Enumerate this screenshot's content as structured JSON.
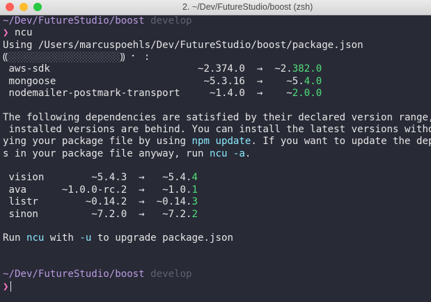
{
  "window": {
    "title": "2. ~/Dev/FutureStudio/boost (zsh)",
    "traffic_lights": [
      {
        "name": "close",
        "color": "#fe5f57"
      },
      {
        "name": "minimize",
        "color": "#febc2e"
      },
      {
        "name": "zoom",
        "color": "#28c840"
      }
    ]
  },
  "terminal": {
    "lines": [
      [
        {
          "t": "~/Dev/FutureStudio/boost",
          "c": "purple"
        },
        {
          "t": " develop",
          "c": "gray"
        }
      ],
      [
        {
          "t": "❯",
          "c": "pink"
        },
        {
          "t": " ncu",
          "c": "default"
        }
      ],
      [
        {
          "t": "Using /Users/marcuspoehls/Dev/FutureStudio/boost/package.json",
          "c": "default"
        }
      ],
      [
        {
          "t": "⸨",
          "c": "default"
        },
        {
          "t": "░░░░░░░░░░░░░░░░░░░",
          "c": "bar"
        },
        {
          "t": "⸩ ⠂ :",
          "c": "default"
        }
      ],
      [
        {
          "t": " aws-sdk                         ~2.374.0  →  ~2.",
          "c": "default"
        },
        {
          "t": "382.0",
          "c": "green"
        }
      ],
      [
        {
          "t": " mongoose                         ~5.3.16  →    ~5.",
          "c": "default"
        },
        {
          "t": "4.0",
          "c": "green"
        }
      ],
      [
        {
          "t": " nodemailer-postmark-transport     ~1.4.0  →    ~",
          "c": "default"
        },
        {
          "t": "2.0.0",
          "c": "green"
        }
      ],
      [],
      [
        {
          "t": "The following dependencies are satisfied by their declared version range, but the",
          "c": "default"
        }
      ],
      [
        {
          "t": " installed versions are behind. You can install the latest versions without modif",
          "c": "default"
        }
      ],
      [
        {
          "t": "ying your package file by using ",
          "c": "default"
        },
        {
          "t": "npm update",
          "c": "cyan"
        },
        {
          "t": ". If you want to update the dependencie",
          "c": "default"
        }
      ],
      [
        {
          "t": "s in your package file anyway, run ",
          "c": "default"
        },
        {
          "t": "ncu -a",
          "c": "cyan"
        },
        {
          "t": ".",
          "c": "default"
        }
      ],
      [],
      [
        {
          "t": " vision        ~5.4.3  →   ~5.4.",
          "c": "default"
        },
        {
          "t": "4",
          "c": "green"
        }
      ],
      [
        {
          "t": " ava      ~1.0.0-rc.2  →   ~1.0.",
          "c": "default"
        },
        {
          "t": "1",
          "c": "green"
        }
      ],
      [
        {
          "t": " listr        ~0.14.2  →  ~0.14.",
          "c": "default"
        },
        {
          "t": "3",
          "c": "green"
        }
      ],
      [
        {
          "t": " sinon         ~7.2.0  →   ~7.2.",
          "c": "default"
        },
        {
          "t": "2",
          "c": "green"
        }
      ],
      [],
      [
        {
          "t": "Run ",
          "c": "default"
        },
        {
          "t": "ncu",
          "c": "cyan"
        },
        {
          "t": " with ",
          "c": "default"
        },
        {
          "t": "-u",
          "c": "cyan"
        },
        {
          "t": " to upgrade package.json",
          "c": "default"
        }
      ],
      [],
      [],
      [
        {
          "t": "~/Dev/FutureStudio/boost",
          "c": "purple"
        },
        {
          "t": " develop",
          "c": "gray"
        }
      ],
      [
        {
          "t": "❯",
          "c": "pink"
        }
      ]
    ]
  }
}
